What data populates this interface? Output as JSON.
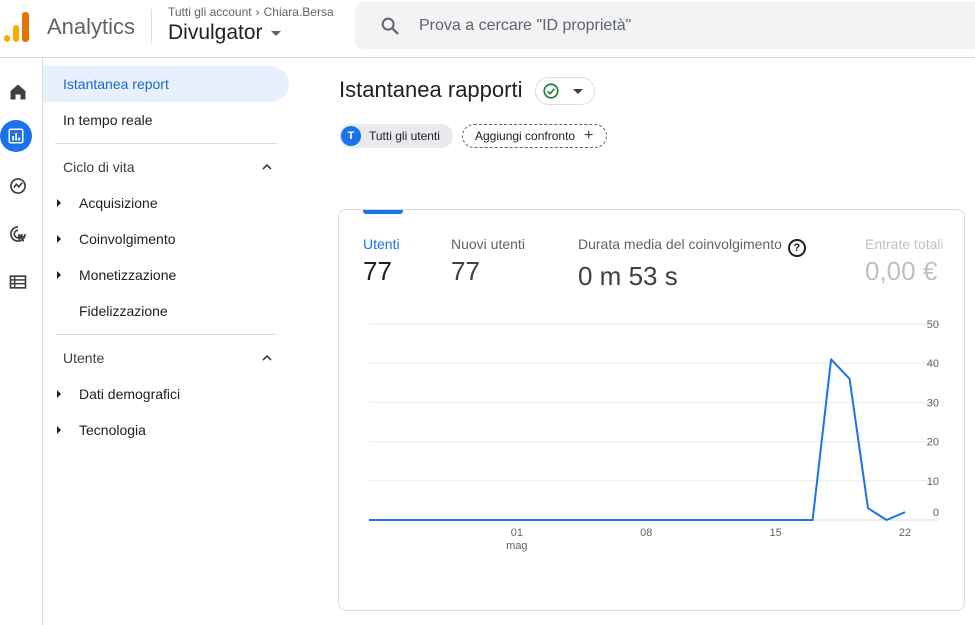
{
  "header": {
    "app_name": "Analytics",
    "breadcrumb": {
      "account": "Tutti gli account",
      "property": "Chiara.Bersa"
    },
    "property_name": "Divulgator",
    "search_placeholder": "Prova a cercare \"ID proprietà\""
  },
  "rail": {
    "items": [
      {
        "icon": "home-icon"
      },
      {
        "icon": "reports-icon",
        "active": true
      },
      {
        "icon": "explore-icon"
      },
      {
        "icon": "advertising-icon"
      },
      {
        "icon": "configure-icon"
      }
    ]
  },
  "sidebar": {
    "top_items": [
      {
        "label": "Istantanea report",
        "selected": true
      },
      {
        "label": "In tempo reale"
      }
    ],
    "lifecycle": {
      "title": "Ciclo di vita",
      "items": [
        {
          "label": "Acquisizione",
          "expandable": true
        },
        {
          "label": "Coinvolgimento",
          "expandable": true
        },
        {
          "label": "Monetizzazione",
          "expandable": true
        },
        {
          "label": "Fidelizzazione",
          "expandable": false
        }
      ]
    },
    "user": {
      "title": "Utente",
      "items": [
        {
          "label": "Dati demografici",
          "expandable": true
        },
        {
          "label": "Tecnologia",
          "expandable": true
        }
      ]
    }
  },
  "main": {
    "title": "Istantanea rapporti",
    "status_color": "#188038",
    "chips": {
      "segment_initial": "T",
      "segment_label": "Tutti gli utenti",
      "add_comparison": "Aggiungi confronto"
    },
    "metrics": [
      {
        "label": "Utenti",
        "value": "77"
      },
      {
        "label": "Nuovi utenti",
        "value": "77"
      },
      {
        "label": "Durata media del coinvolgimento",
        "value": "0 m 53 s"
      },
      {
        "label": "Entrate totali",
        "value": "0,00 €"
      }
    ]
  },
  "chart_data": {
    "type": "line",
    "series": [
      {
        "color": "#1a73e8",
        "x": [
          "2023-04-23",
          "2023-04-24",
          "2023-04-25",
          "2023-04-26",
          "2023-04-27",
          "2023-04-28",
          "2023-04-29",
          "2023-04-30",
          "2023-05-01",
          "2023-05-02",
          "2023-05-03",
          "2023-05-04",
          "2023-05-05",
          "2023-05-06",
          "2023-05-07",
          "2023-05-08",
          "2023-05-09",
          "2023-05-10",
          "2023-05-11",
          "2023-05-12",
          "2023-05-13",
          "2023-05-14",
          "2023-05-15",
          "2023-05-16",
          "2023-05-17",
          "2023-05-18",
          "2023-05-19",
          "2023-05-20",
          "2023-05-21",
          "2023-05-22"
        ],
        "values": [
          0,
          0,
          0,
          0,
          0,
          0,
          0,
          0,
          0,
          0,
          0,
          0,
          0,
          0,
          0,
          0,
          0,
          0,
          0,
          0,
          0,
          0,
          0,
          0,
          0,
          41,
          36,
          3,
          0,
          2
        ]
      }
    ],
    "x_ticks": [
      {
        "label": "01",
        "sublabel": "mag",
        "date": "2023-05-01"
      },
      {
        "label": "08",
        "sublabel": "",
        "date": "2023-05-08"
      },
      {
        "label": "15",
        "sublabel": "",
        "date": "2023-05-15"
      },
      {
        "label": "22",
        "sublabel": "",
        "date": "2023-05-22"
      }
    ],
    "y_ticks": [
      0,
      10,
      20,
      30,
      40,
      50
    ],
    "ylim": [
      0,
      50
    ],
    "y_axis_position": "right",
    "grid": true
  }
}
